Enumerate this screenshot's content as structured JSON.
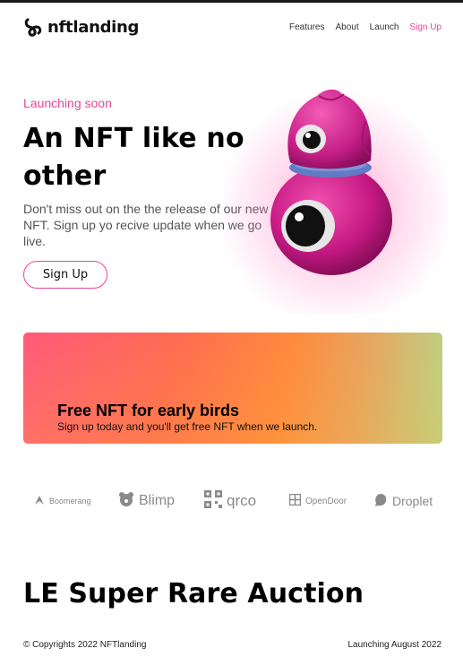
{
  "brand": {
    "name": "nftlanding",
    "icon": "infinity-loop-logo-icon"
  },
  "nav": {
    "items": [
      {
        "label": "Features"
      },
      {
        "label": "About"
      },
      {
        "label": "Launch"
      },
      {
        "label": "Sign Up",
        "accent": true
      }
    ]
  },
  "hero": {
    "kicker": "Launching soon",
    "title": "An NFT like no other",
    "description": "Don't miss out on the the release of our new NFT. Sign up yo recive update when we go live.",
    "cta_label": "Sign Up",
    "image": "pink-one-eyed-mascot-with-helmet"
  },
  "banner": {
    "title": "Free NFT for early birds",
    "subtitle": "Sign up today and you'll get free NFT when we launch."
  },
  "partners": [
    {
      "name": "Boomerang",
      "icon": "boomerang-icon"
    },
    {
      "name": "Blimp",
      "icon": "bear-icon"
    },
    {
      "name": "qrco",
      "icon": "qr-code-icon"
    },
    {
      "name": "OpenDoor",
      "icon": "door-grid-icon"
    },
    {
      "name": "Droplet",
      "icon": "droplet-icon"
    }
  ],
  "auction": {
    "title": "LE Super Rare Auction"
  },
  "footer": {
    "copyright": "© Copyrights 2022 NFTlanding",
    "launch_note": "Launching August 2022"
  },
  "colors": {
    "accent": "#e8459b",
    "text": "#111111",
    "muted": "#555555",
    "banner_gradient": [
      "#ff5a7a",
      "#ff6b52",
      "#ff8a3d",
      "#b6d98c"
    ]
  }
}
